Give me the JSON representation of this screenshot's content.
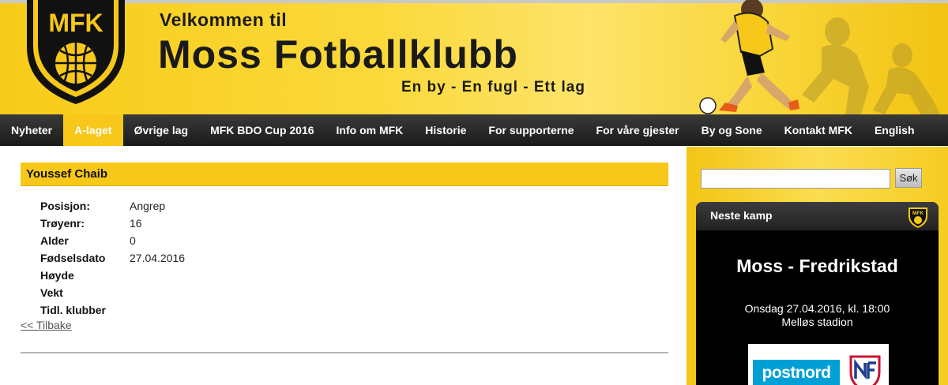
{
  "header": {
    "welcome": "Velkommen til",
    "club_name": "Moss Fotballklubb",
    "slogan": "En by - En fugl - Ett lag",
    "logo_text": "MFK"
  },
  "nav": {
    "items": [
      {
        "label": "Nyheter",
        "active": false
      },
      {
        "label": "A-laget",
        "active": true
      },
      {
        "label": "Øvrige lag",
        "active": false
      },
      {
        "label": "MFK BDO Cup 2016",
        "active": false
      },
      {
        "label": "Info om MFK",
        "active": false
      },
      {
        "label": "Historie",
        "active": false
      },
      {
        "label": "For supporterne",
        "active": false
      },
      {
        "label": "For våre gjester",
        "active": false
      },
      {
        "label": "By og Sone",
        "active": false
      },
      {
        "label": "Kontakt MFK",
        "active": false
      },
      {
        "label": "English",
        "active": false
      }
    ]
  },
  "player": {
    "name": "Youssef Chaib",
    "fields": [
      {
        "label": "Posisjon:",
        "value": "Angrep"
      },
      {
        "label": "Trøyenr:",
        "value": "16"
      },
      {
        "label": "Alder",
        "value": "0"
      },
      {
        "label": "Fødselsdato",
        "value": "27.04.2016"
      },
      {
        "label": "Høyde",
        "value": ""
      },
      {
        "label": "Vekt",
        "value": ""
      },
      {
        "label": "Tidl. klubber",
        "value": ""
      }
    ],
    "back_link": "<< Tilbake"
  },
  "sidebar": {
    "search_placeholder": "",
    "search_button": "Søk",
    "next_match": {
      "heading": "Neste kamp",
      "teams": "Moss - Fredrikstad",
      "date_time": "Onsdag 27.04.2016, kl. 18:00",
      "venue": "Melløs stadion",
      "sponsor_text": "postnord",
      "logo_text": "MFK"
    }
  },
  "colors": {
    "brand_yellow": "#f7c81a",
    "nav_dark": "#1a1a1a",
    "postnord_blue": "#00a0d6"
  },
  "icons": {
    "club_logo": "mfk-shield-logo",
    "nff_logo": "nff-badge-logo"
  }
}
